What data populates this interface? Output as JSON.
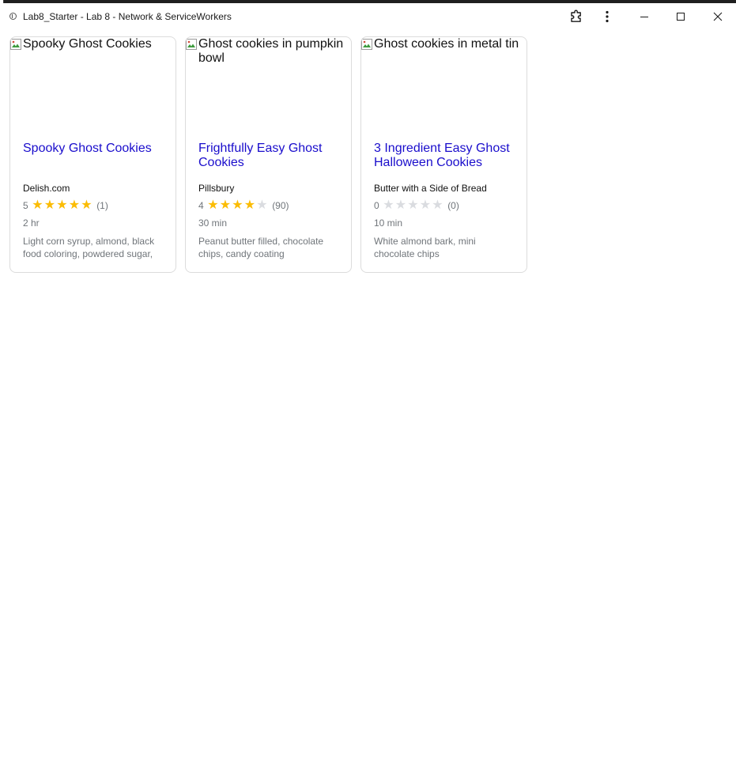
{
  "window": {
    "title": "Lab8_Starter - Lab 8 - Network & ServiceWorkers"
  },
  "icons": {
    "site": "site-info-icon",
    "extensions": "puzzle-piece-icon",
    "menu": "kebab-menu-icon",
    "minimize": "minimize-icon",
    "maximize": "maximize-icon",
    "close": "close-icon"
  },
  "colors": {
    "link": "#1a0dcc",
    "star_on": "#fbbc04",
    "star_off": "#dadce0",
    "muted_text": "#70757a",
    "card_border": "#dcdcdc"
  },
  "recipes": [
    {
      "image_alt": "Spooky Ghost Cookies",
      "title": "Spooky Ghost Cookies",
      "organization": "Delish.com",
      "rating": "5",
      "rating_value": 5,
      "review_count": "(1)",
      "time": "2 hr",
      "ingredients": "Light corn syrup, almond, black food coloring, powdered sugar,"
    },
    {
      "image_alt": "Ghost cookies in pumpkin bowl",
      "title": "Frightfully Easy Ghost Cookies",
      "organization": "Pillsbury",
      "rating": "4",
      "rating_value": 4,
      "review_count": "(90)",
      "time": "30 min",
      "ingredients": "Peanut butter filled, chocolate chips, candy coating"
    },
    {
      "image_alt": "Ghost cookies in metal tin",
      "title": "3 Ingredient Easy Ghost Halloween Cookies",
      "organization": "Butter with a Side of Bread",
      "rating": "0",
      "rating_value": 0,
      "review_count": "(0)",
      "time": "10 min",
      "ingredients": "White almond bark, mini chocolate chips"
    }
  ]
}
